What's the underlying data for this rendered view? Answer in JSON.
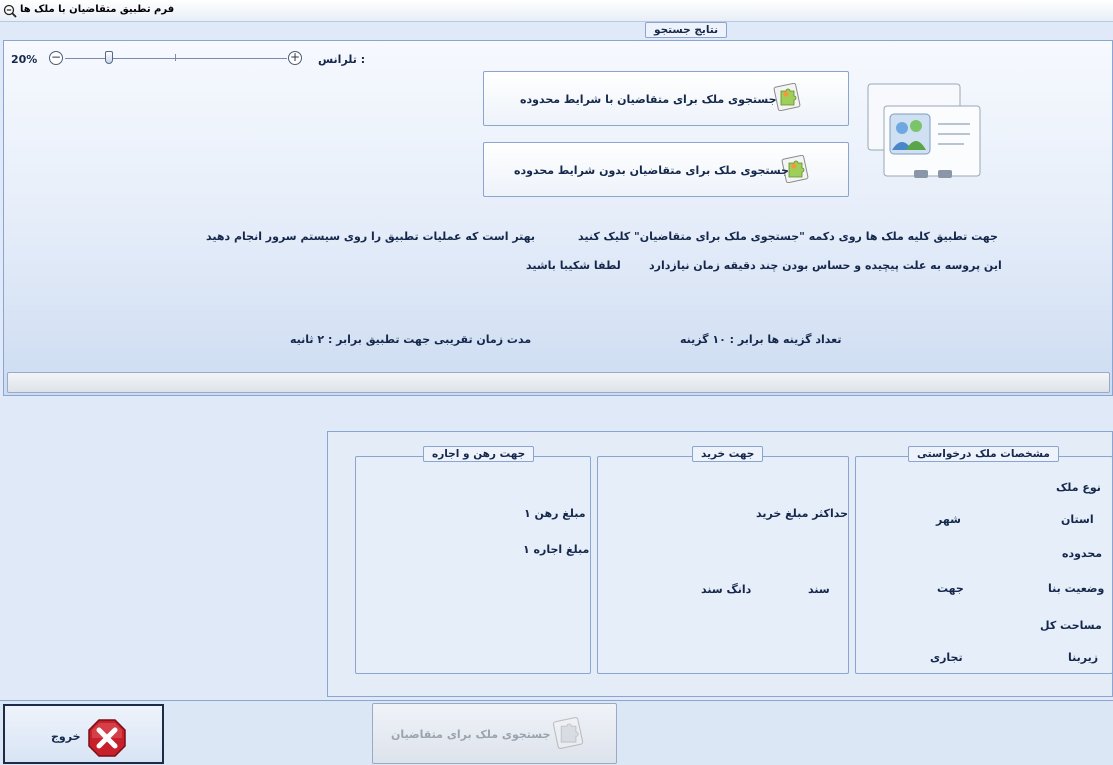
{
  "window": {
    "title": "فرم تطبیق متقاضیان با ملک ها"
  },
  "results": {
    "legend": "نتایج جستجو",
    "zoom_percent": "20%",
    "zoom_level": 0.2,
    "tolerance_label": "تلرانس :",
    "btn_limited": "جستجوی ملک برای متقاضیان با شرایط محدوده",
    "btn_unlimited": "جستجوی ملک برای متقاضیان بدون شرایط محدوده",
    "info_line1_right": "جهت تطبیق کلیه ملک ها روی دکمه \"جستجوی ملک برای متقاضیان\" کلیک کنید",
    "info_line1_left": "بهتر است که عملیات تطبیق را روی سیستم سرور انجام دهید",
    "info_line2_right": "این پروسه به علت پیچیده و حساس بودن چند دقیقه زمان نیازدارد",
    "info_line2_left": "لطفا شکیبا باشید",
    "count_text": "تعداد گزینه ها برابر :  ۱۰ گزینه",
    "time_text": "مدت زمان تقریبی جهت تطبیق برابر :   ۲ ثانیه"
  },
  "property_spec": {
    "legend": "مشخصات ملک درخواستی",
    "type_label": "نوع ملک",
    "province_label": "استان",
    "city_label": "شهر",
    "area_label": "محدوده",
    "status_label": "وضعیت بنا",
    "direction_label": "جهت",
    "total_area_label": "مساحت کل",
    "sub_area_label": "زیربنا",
    "usage_label": "تجاری"
  },
  "purchase": {
    "legend": "جهت خرید",
    "max_price_label": "حداکثر مبلغ خرید",
    "deed_label": "سند",
    "deed_share_label": "دانگ سند"
  },
  "rent": {
    "legend": "جهت رهن و اجاره",
    "mortgage_label": "مبلغ رهن ۱",
    "rent_label": "مبلغ اجاره ۱"
  },
  "actions": {
    "search_label": "جستجوی ملک برای متقاضیان",
    "exit_label": "خروج"
  }
}
